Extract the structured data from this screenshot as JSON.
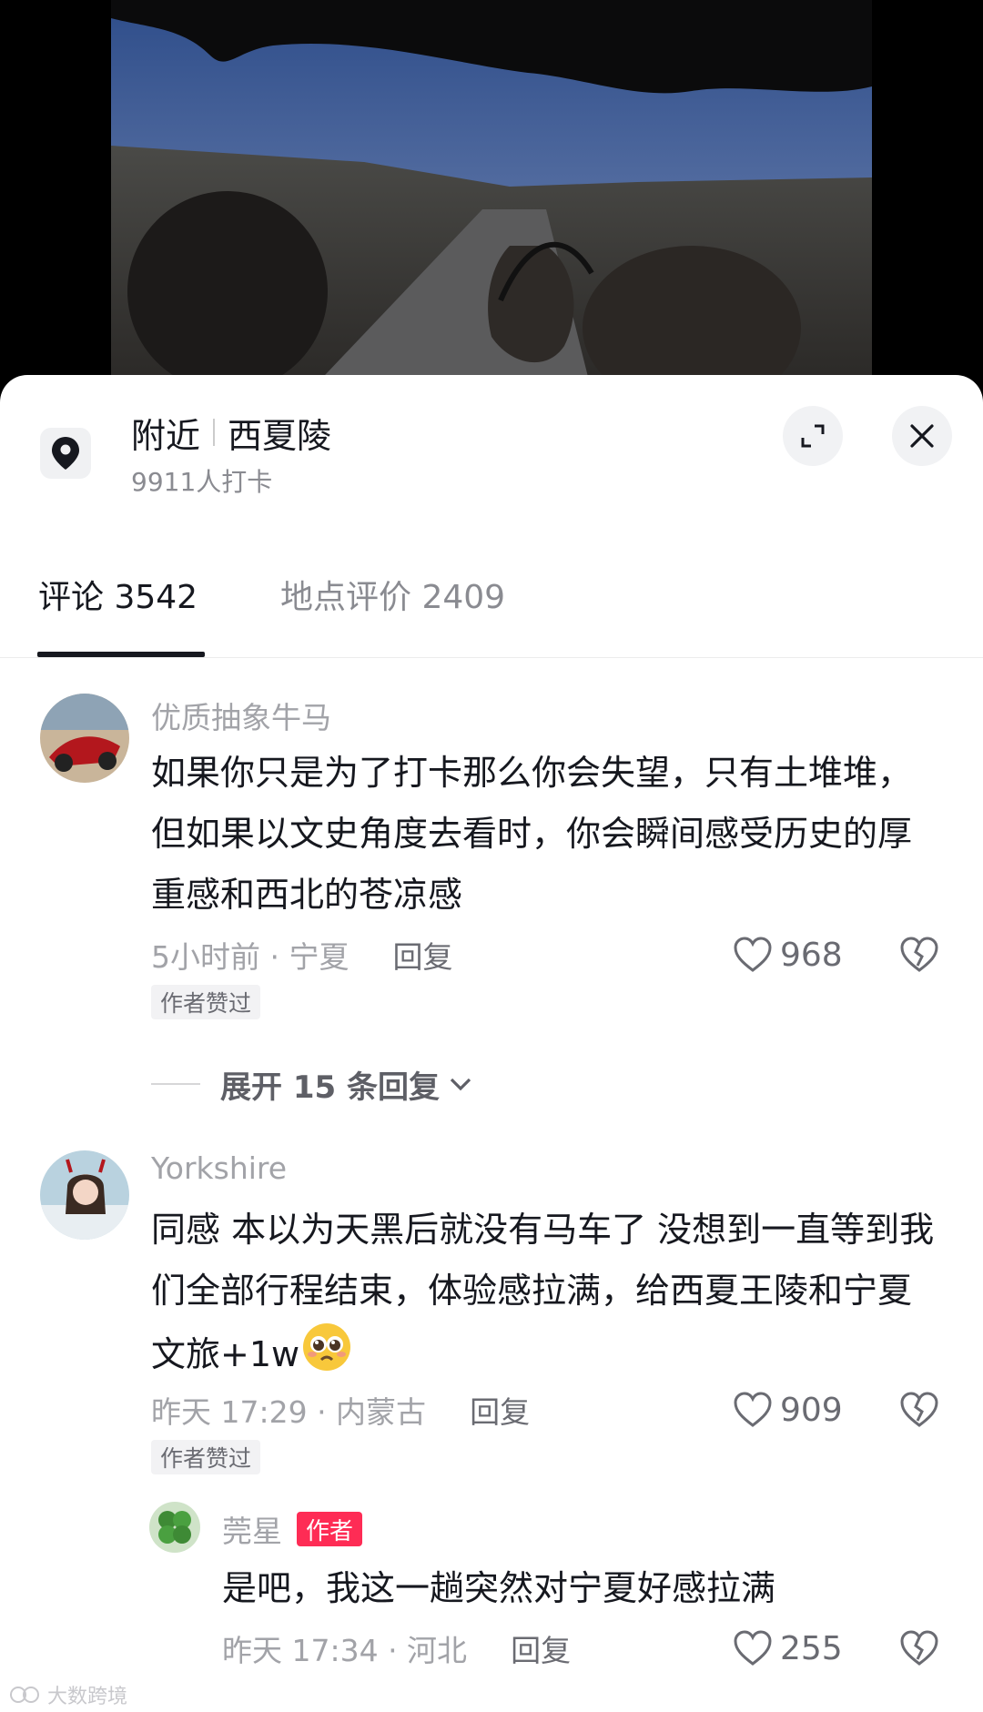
{
  "location": {
    "prefix": "附近",
    "name": "西夏陵",
    "checkins": "9911人打卡"
  },
  "tabs": [
    {
      "label": "评论 3542"
    },
    {
      "label": "地点评价 2409"
    }
  ],
  "comments": [
    {
      "user": "优质抽象牛马",
      "text": "如果你只是为了打卡那么你会失望，只有土堆堆，但如果以文史角度去看时，你会瞬间感受历史的厚重感和西北的苍凉感",
      "meta": "5小时前 · 宁夏",
      "reply_label": "回复",
      "likes": "968",
      "badge": "作者赞过",
      "expand": "展开 15 条回复"
    },
    {
      "user": "Yorkshire",
      "text": "同感 本以为天黑后就没有马车了 没想到一直等到我们全部行程结束，体验感拉满，给西夏王陵和宁夏文旅+1w",
      "meta": "昨天 17:29 · 内蒙古",
      "reply_label": "回复",
      "likes": "909",
      "badge": "作者赞过"
    }
  ],
  "reply": {
    "user": "莞星",
    "tag": "作者",
    "text": "是吧，我这一趟突然对宁夏好感拉满",
    "meta": "昨天 17:34 · 河北",
    "reply_label": "回复",
    "likes": "255"
  },
  "watermark": "大数跨境",
  "colors": {
    "author_tag": "#fe2c55",
    "text_primary": "#16181f",
    "text_secondary": "#a2a3a8"
  }
}
